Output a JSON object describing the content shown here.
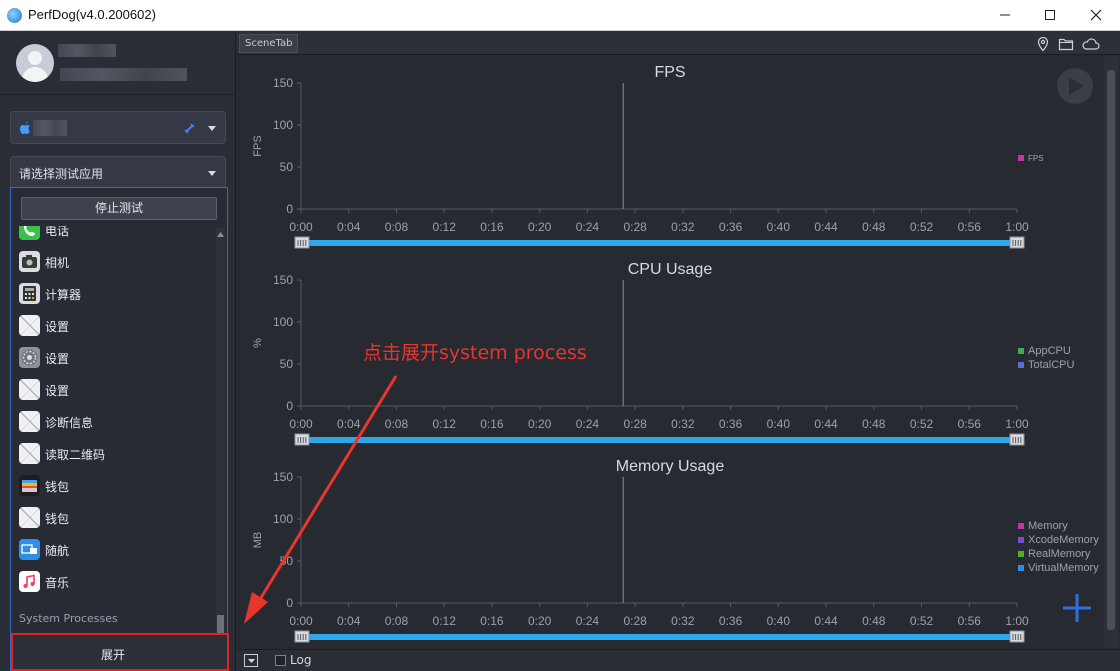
{
  "window": {
    "title": "PerfDog(v4.0.200602)",
    "minimize_icon": "minimize-icon",
    "maximize_icon": "maximize-icon",
    "close_icon": "close-icon"
  },
  "sidebar": {
    "app_select_label": "请选择测试应用",
    "stop_button": "停止测试",
    "apps": [
      {
        "label": "电话",
        "icon": "phone-icon",
        "color": "#38c24a"
      },
      {
        "label": "相机",
        "icon": "camera-icon",
        "color": "#d9dce1"
      },
      {
        "label": "计算器",
        "icon": "calculator-icon",
        "color": "#d9dce1"
      },
      {
        "label": "设置",
        "icon": "placeholder-icon",
        "color": "#eef0f3"
      },
      {
        "label": "设置",
        "icon": "settings-gear-icon",
        "color": "#8e939b"
      },
      {
        "label": "设置",
        "icon": "placeholder-icon",
        "color": "#eef0f3"
      },
      {
        "label": "诊断信息",
        "icon": "placeholder-icon",
        "color": "#eef0f3"
      },
      {
        "label": "读取二维码",
        "icon": "placeholder-icon",
        "color": "#eef0f3"
      },
      {
        "label": "钱包",
        "icon": "wallet-icon",
        "color": "#1e1e1e"
      },
      {
        "label": "钱包",
        "icon": "placeholder-icon",
        "color": "#eef0f3"
      },
      {
        "label": "随航",
        "icon": "sidecar-icon",
        "color": "#2f8fe8"
      },
      {
        "label": "音乐",
        "icon": "music-icon",
        "color": "#ffffff"
      }
    ],
    "system_processes_label": "System Processes",
    "expand_button": "展开"
  },
  "main": {
    "scene_tab": "SceneTab",
    "log_label": "Log",
    "annotation": "点击展开system process"
  },
  "chart_data": [
    {
      "type": "line",
      "title": "FPS",
      "ylabel": "FPS",
      "ylim": [
        0,
        150
      ],
      "yticks": [
        "0",
        "50",
        "100",
        "150"
      ],
      "xticks": [
        "0:00",
        "0:04",
        "0:08",
        "0:12",
        "0:16",
        "0:20",
        "0:24",
        "0:28",
        "0:32",
        "0:36",
        "0:40",
        "0:44",
        "0:48",
        "0:52",
        "0:56",
        "1:00"
      ],
      "cursor": "0:27",
      "series": [
        {
          "name": "FPS",
          "color": "#c0399f",
          "values": []
        }
      ]
    },
    {
      "type": "line",
      "title": "CPU Usage",
      "ylabel": "%",
      "ylim": [
        0,
        150
      ],
      "yticks": [
        "0",
        "50",
        "100",
        "150"
      ],
      "xticks": [
        "0:00",
        "0:04",
        "0:08",
        "0:12",
        "0:16",
        "0:20",
        "0:24",
        "0:28",
        "0:32",
        "0:36",
        "0:40",
        "0:44",
        "0:48",
        "0:52",
        "0:56",
        "1:00"
      ],
      "cursor": "0:27",
      "series": [
        {
          "name": "AppCPU",
          "color": "#3fae4c",
          "values": []
        },
        {
          "name": "TotalCPU",
          "color": "#5a6fd8",
          "values": []
        }
      ]
    },
    {
      "type": "line",
      "title": "Memory Usage",
      "ylabel": "MB",
      "ylim": [
        0,
        150
      ],
      "yticks": [
        "0",
        "50",
        "100",
        "150"
      ],
      "xticks": [
        "0:00",
        "0:04",
        "0:08",
        "0:12",
        "0:16",
        "0:20",
        "0:24",
        "0:28",
        "0:32",
        "0:36",
        "0:40",
        "0:44",
        "0:48",
        "0:52",
        "0:56",
        "1:00"
      ],
      "cursor": "0:27",
      "series": [
        {
          "name": "Memory",
          "color": "#c0399f",
          "values": []
        },
        {
          "name": "XcodeMemory",
          "color": "#7c4ad4",
          "values": []
        },
        {
          "name": "RealMemory",
          "color": "#4fae2a",
          "values": []
        },
        {
          "name": "VirtualMemory",
          "color": "#2f8fe8",
          "values": []
        }
      ]
    }
  ]
}
